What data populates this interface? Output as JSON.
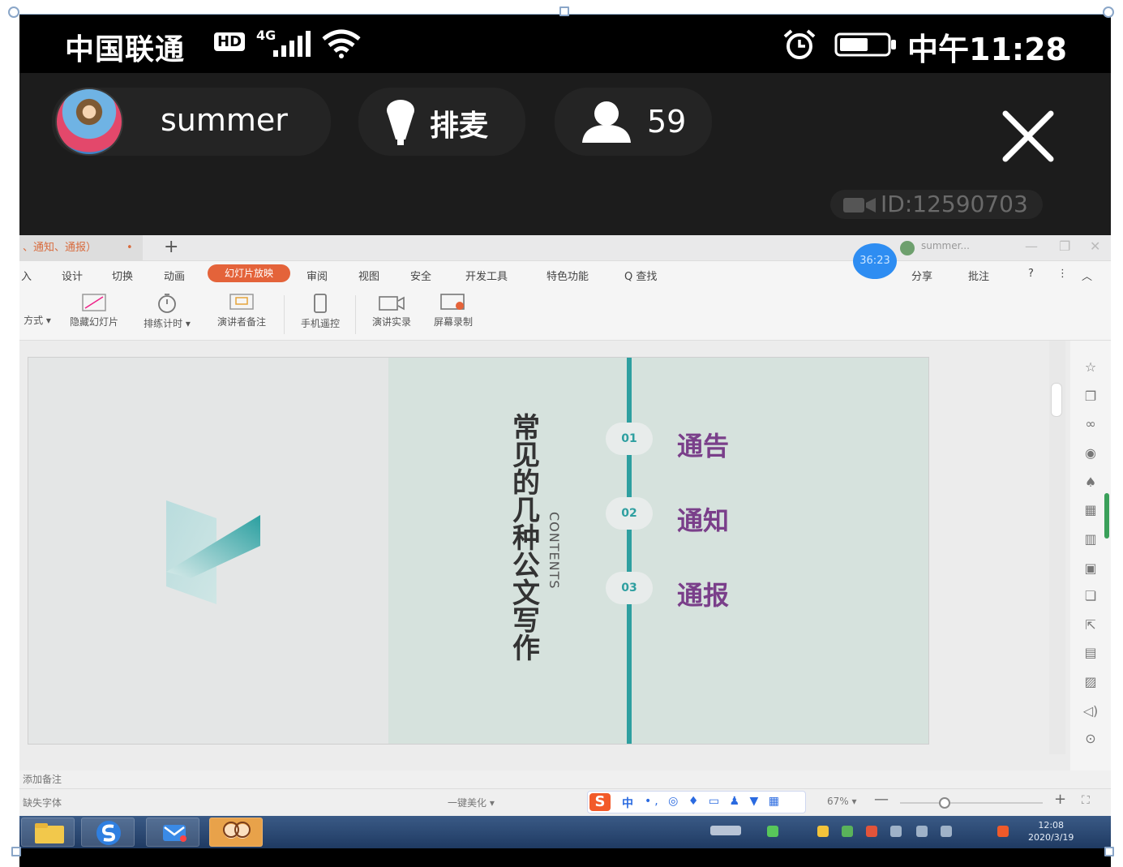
{
  "status_bar": {
    "carrier": "中国联通",
    "hd": "HD",
    "network": "4G",
    "time": "中午11:28"
  },
  "live": {
    "host_name": "summer",
    "queue_label": "排麦",
    "viewer_count": "59",
    "room_id": "ID:12590703"
  },
  "wps": {
    "doc_tab": "、通知、通报）",
    "doc_tab_close": "•",
    "new_tab": "+",
    "user_name": "summer...",
    "window_buttons": [
      "—",
      "❐",
      "✕"
    ],
    "timer": "36:23",
    "menu": [
      "入",
      "设计",
      "切换",
      "动画",
      "审阅",
      "视图",
      "安全",
      "开发工具",
      "特色功能",
      "Q 查找"
    ],
    "menu_active": "幻灯片放映",
    "menu_right": [
      "分享",
      "批注",
      "?",
      "⋮",
      "︿"
    ],
    "ribbon": [
      "方式 ▾",
      "隐藏幻灯片",
      "排练计时 ▾",
      "演讲者备注",
      "手机遥控",
      "演讲实录",
      "屏幕录制"
    ],
    "notes_placeholder": "添加备注",
    "status_missing_font": "缺失字体",
    "status_beautify": "一键美化 ▾",
    "zoom": "67% ▾",
    "zoom_minus": "—",
    "zoom_plus": "+"
  },
  "slide": {
    "title": "常见的几种公文写作",
    "subtitle": "CONTENTS",
    "items": [
      {
        "num": "01",
        "label": "通告"
      },
      {
        "num": "02",
        "label": "通知"
      },
      {
        "num": "03",
        "label": "通报"
      }
    ]
  },
  "ime": {
    "logo": "S",
    "mode": "中",
    "tools": "•, ◎ ♦ ▭ ♟ ▼ ▦"
  },
  "taskbar": {
    "time": "12:08",
    "date": "2020/3/19"
  },
  "colors": {
    "accent_teal": "#2e9fa0",
    "item_purple": "#7a3f8a",
    "menu_active": "#e4633a",
    "timer_blue": "#2e8df2"
  }
}
